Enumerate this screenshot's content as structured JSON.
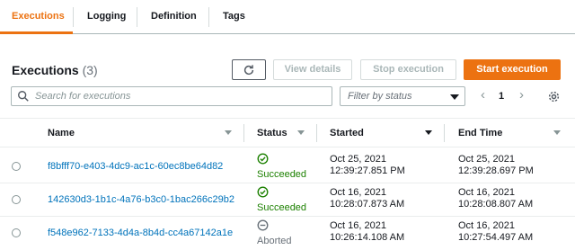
{
  "tabs": [
    {
      "label": "Executions",
      "active": true
    },
    {
      "label": "Logging",
      "active": false
    },
    {
      "label": "Definition",
      "active": false
    },
    {
      "label": "Tags",
      "active": false
    }
  ],
  "header": {
    "title": "Executions",
    "count": "(3)",
    "buttons": {
      "refresh_icon": "refresh-icon",
      "view_details": "View details",
      "stop_execution": "Stop execution",
      "start_execution": "Start execution"
    }
  },
  "search": {
    "placeholder": "Search for executions"
  },
  "filter": {
    "placeholder": "Filter by status"
  },
  "pagination": {
    "current_page": "1"
  },
  "table": {
    "columns": {
      "name": "Name",
      "status": "Status",
      "started": "Started",
      "end_time": "End Time"
    },
    "rows": [
      {
        "name": "f8bfff70-e403-4dc9-ac1c-60ec8be64d82",
        "status": "Succeeded",
        "status_icon": "check-circle-icon",
        "started_date": "Oct 25, 2021",
        "started_time": "12:39:27.851 PM",
        "end_date": "Oct 25, 2021",
        "end_time": "12:39:28.697 PM"
      },
      {
        "name": "142630d3-1b1c-4a76-b3c0-1bac266c29b2",
        "status": "Succeeded",
        "status_icon": "check-circle-icon",
        "started_date": "Oct 16, 2021",
        "started_time": "10:28:07.873 AM",
        "end_date": "Oct 16, 2021",
        "end_time": "10:28:08.807 AM"
      },
      {
        "name": "f548e962-7133-4d4a-8b4d-cc4a67142a1e",
        "status": "Aborted",
        "status_icon": "minus-circle-icon",
        "started_date": "Oct 16, 2021",
        "started_time": "10:26:14.108 AM",
        "end_date": "Oct 16, 2021",
        "end_time": "10:27:54.497 AM"
      }
    ]
  },
  "colors": {
    "accent": "#ec7211",
    "link": "#0073bb",
    "success": "#1d8102",
    "muted": "#687078"
  }
}
